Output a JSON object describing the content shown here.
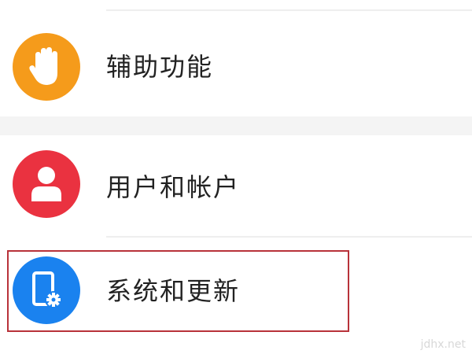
{
  "settings_list": {
    "items": [
      {
        "id": "accessibility",
        "label": "辅助功能",
        "icon": "hand-icon",
        "icon_color": "#f59b1b"
      },
      {
        "id": "users_accounts",
        "label": "用户和帐户",
        "icon": "user-icon",
        "icon_color": "#ea3240"
      },
      {
        "id": "system_updates",
        "label": "系统和更新",
        "icon": "phone-gear-icon",
        "icon_color": "#1a82ef",
        "highlighted": true
      }
    ]
  },
  "colors": {
    "highlight_border": "#b8323a",
    "divider": "#eeeeee",
    "section_gap": "#f4f4f4"
  },
  "watermark": "jdhx.net"
}
